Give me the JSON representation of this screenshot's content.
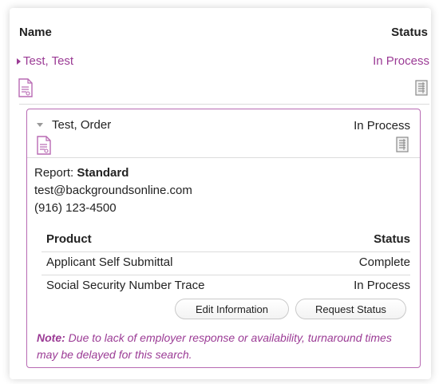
{
  "header": {
    "name_label": "Name",
    "status_label": "Status"
  },
  "parent_row": {
    "name": "Test, Test",
    "status": "In Process",
    "icons": [
      "document-icon",
      "report-icon"
    ]
  },
  "order": {
    "name": "Test, Order",
    "status": "In Process",
    "report_label": "Report:",
    "report_type": "Standard",
    "email": "test@backgroundsonline.com",
    "phone": "(916) 123-4500",
    "products": {
      "columns": [
        "Product",
        "Status"
      ],
      "rows": [
        {
          "product": "Applicant Self Submittal",
          "status": "Complete"
        },
        {
          "product": "Social Security Number Trace",
          "status": "In Process"
        }
      ]
    },
    "buttons": {
      "edit": "Edit Information",
      "request": "Request Status"
    },
    "note_label": "Note:",
    "note_text": " Due to lack of employer response or availability, turnaround times may be delayed for this search."
  },
  "colors": {
    "accent": "#9b3b95",
    "border": "#b86ab3"
  }
}
